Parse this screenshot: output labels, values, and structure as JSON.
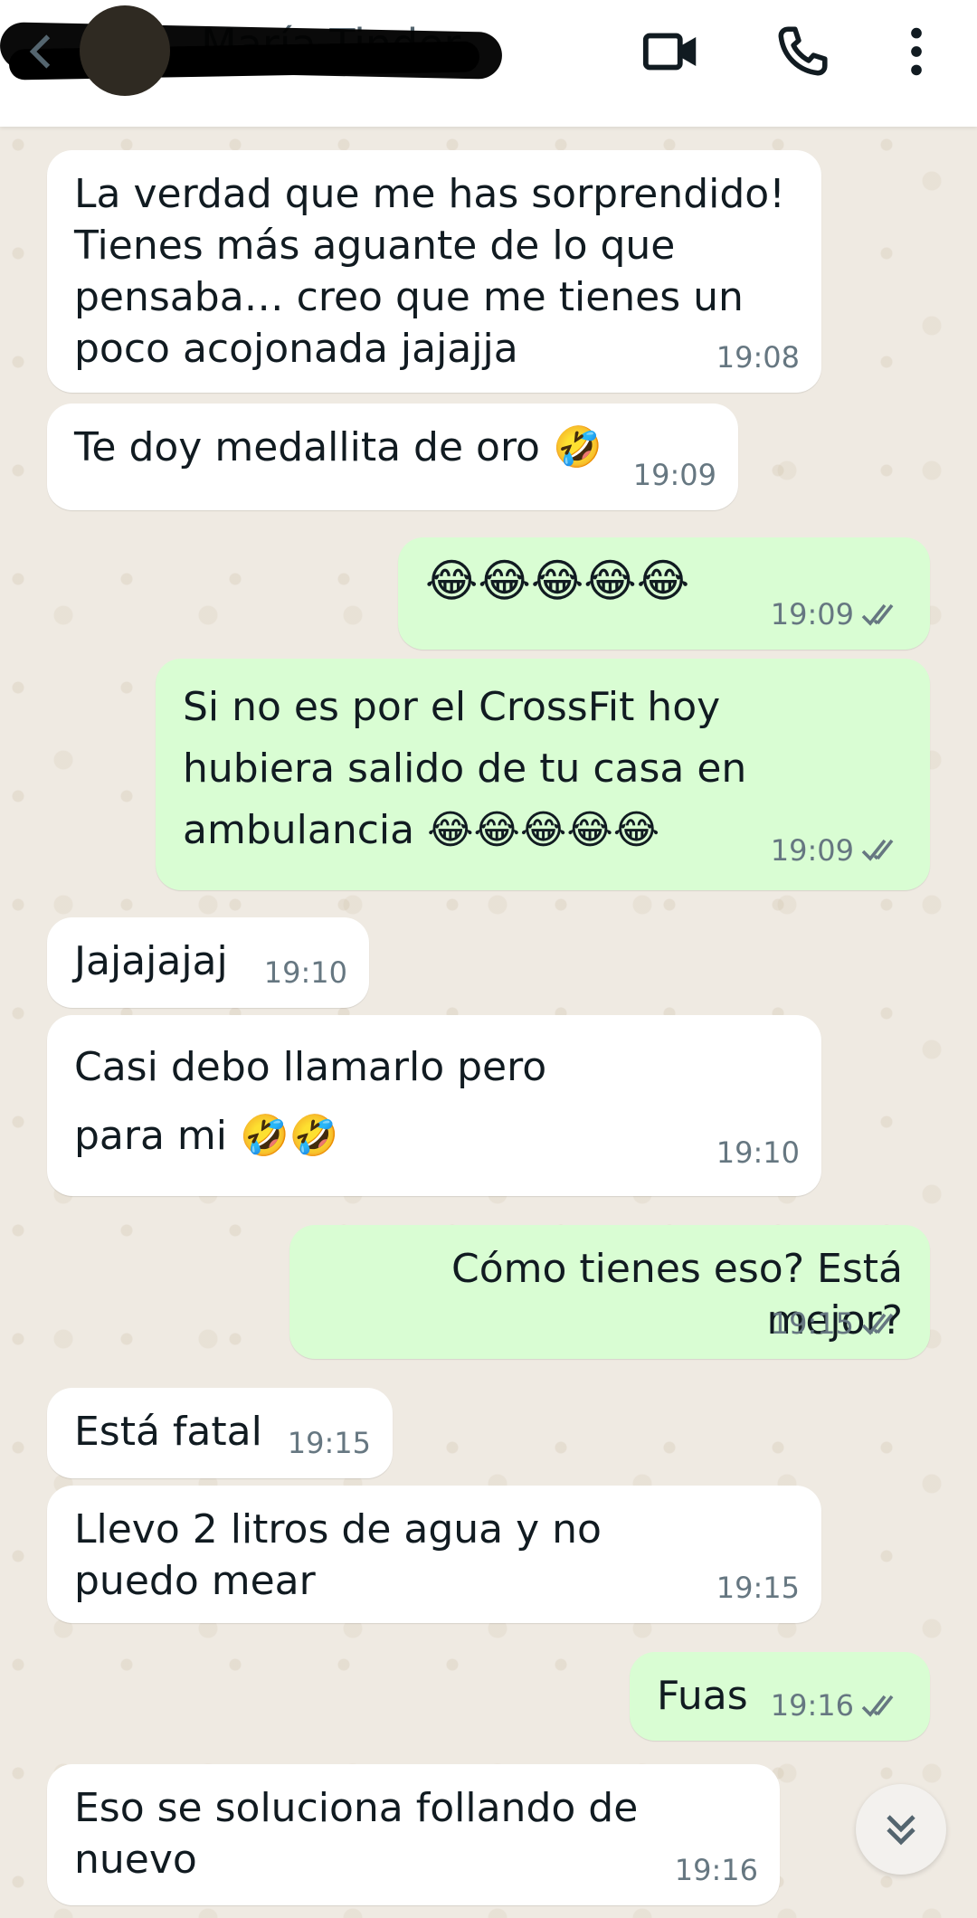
{
  "header": {
    "contact_name": "María Tinder",
    "icons": [
      "back-arrow-icon",
      "video-call-icon",
      "voice-call-icon",
      "more-options-icon"
    ]
  },
  "messages": [
    {
      "dir": "in",
      "text": "La verdad que me has sorprendido! Tienes más aguante de lo que pensaba… creo que me tienes un poco acojonada jajajja",
      "time": "19:08"
    },
    {
      "dir": "in",
      "text": "Te doy medallita de oro 🤣",
      "time": "19:09"
    },
    {
      "dir": "out",
      "text": "😂😂😂😂😂",
      "time": "19:09",
      "status": "read"
    },
    {
      "dir": "out",
      "text": "Si no es por el CrossFit hoy hubiera salido de tu casa en ambulancia 😂😂😂😂😂",
      "time": "19:09",
      "status": "read"
    },
    {
      "dir": "in",
      "text": "Jajajajaj",
      "time": "19:10"
    },
    {
      "dir": "in",
      "text": "Casi debo llamarlo pero para mi 🤣🤣",
      "time": "19:10"
    },
    {
      "dir": "out",
      "text": "Cómo tienes eso? Está mejor?",
      "time": "19:15",
      "status": "read"
    },
    {
      "dir": "in",
      "text": "Está fatal",
      "time": "19:15"
    },
    {
      "dir": "in",
      "text": "Llevo 2 litros de agua y no puedo mear",
      "time": "19:15"
    },
    {
      "dir": "out",
      "text": "Fuas",
      "time": "19:16",
      "status": "read"
    },
    {
      "dir": "in",
      "text": "Eso se soluciona follando de nuevo",
      "time": "19:16"
    }
  ],
  "colors": {
    "incoming": "#ffffff",
    "outgoing": "#d9fdd3",
    "background": "#efeae2",
    "read_tick": "#667781"
  }
}
